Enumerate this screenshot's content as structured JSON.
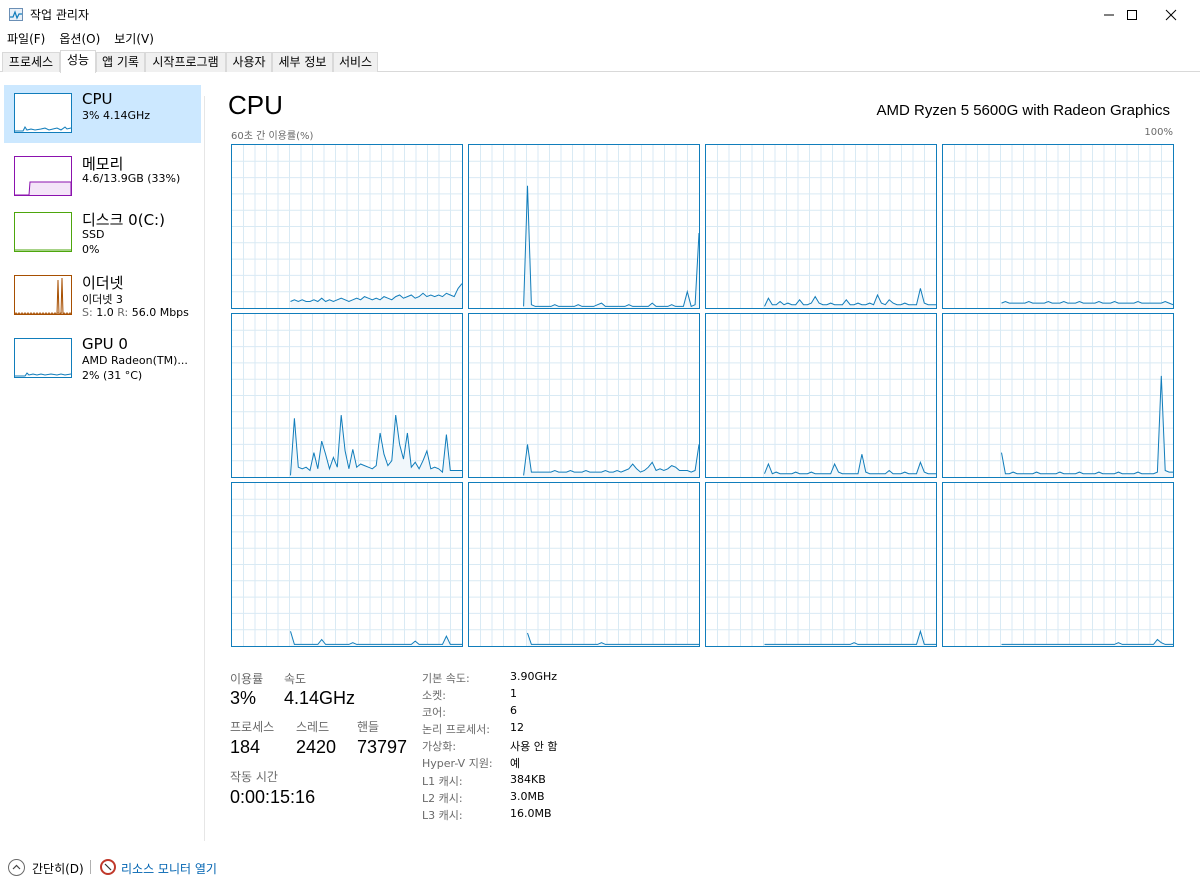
{
  "window": {
    "title": "작업 관리자"
  },
  "menu": [
    "파일(F)",
    "옵션(O)",
    "보기(V)"
  ],
  "tabs": [
    "프로세스",
    "성능",
    "앱 기록",
    "시작프로그램",
    "사용자",
    "세부 정보",
    "서비스"
  ],
  "active_tab": "성능",
  "resources": [
    {
      "title": "CPU",
      "sub1": "3% 4.14GHz",
      "sub2": "",
      "color": "#117dbb"
    },
    {
      "title": "메모리",
      "sub1": "4.6/13.9GB (33%)",
      "sub2": "",
      "color": "#8b12ae"
    },
    {
      "title": "디스크 0(C:)",
      "sub1": "SSD",
      "sub2": "0%",
      "color": "#4da60c"
    },
    {
      "title": "이더넷",
      "sub1": "이더넷 3",
      "sub2_s_label": "S:",
      "sub2_s_value": "1.0",
      "sub2_r_label": "R:",
      "sub2_r_value": "56.0 Mbps",
      "color": "#a74f01"
    },
    {
      "title": "GPU 0",
      "sub1": "AMD Radeon(TM)...",
      "sub2": "2% (31 °C)",
      "color": "#117dbb"
    }
  ],
  "main": {
    "title": "CPU",
    "model": "AMD Ryzen 5 5600G with Radeon Graphics",
    "axis_label": "60초 간 이용률(%)",
    "axis_max": "100%"
  },
  "stats": {
    "utilization_label": "이용률",
    "utilization": "3%",
    "speed_label": "속도",
    "speed": "4.14GHz",
    "processes_label": "프로세스",
    "processes": "184",
    "threads_label": "스레드",
    "threads": "2420",
    "handles_label": "핸들",
    "handles": "73797",
    "uptime_label": "작동 시간",
    "uptime": "0:00:15:16"
  },
  "specs": [
    {
      "label": "기본 속도:",
      "value": "3.90GHz"
    },
    {
      "label": "소켓:",
      "value": "1"
    },
    {
      "label": "코어:",
      "value": "6"
    },
    {
      "label": "논리 프로세서:",
      "value": "12"
    },
    {
      "label": "가상화:",
      "value": "사용 안 함"
    },
    {
      "label": "Hyper-V 지원:",
      "value": "예"
    },
    {
      "label": "L1 캐시:",
      "value": "384KB"
    },
    {
      "label": "L2 캐시:",
      "value": "3.0MB"
    },
    {
      "label": "L3 캐시:",
      "value": "16.0MB"
    }
  ],
  "footer": {
    "less": "간단히(D)",
    "resmon": "리소스 모니터 열기"
  },
  "colors": {
    "cpu": "#117dbb",
    "memory": "#8b12ae",
    "disk": "#4da60c",
    "ethernet": "#a74f01",
    "selected": "#cce8ff"
  },
  "chart_data": {
    "type": "line",
    "x": [
      0,
      1,
      2,
      3,
      4,
      5,
      6,
      7,
      8,
      9,
      10,
      11,
      12,
      13,
      14,
      15,
      16,
      17,
      18,
      19,
      20,
      21,
      22,
      23,
      24,
      25,
      26,
      27,
      28,
      29,
      30,
      31,
      32,
      33,
      34,
      35,
      36,
      37,
      38,
      39,
      40,
      41,
      42,
      43,
      44,
      45,
      46,
      47,
      48,
      49,
      50,
      51,
      52,
      53,
      54,
      55,
      56,
      57,
      58,
      59
    ],
    "xlim": [
      0,
      60
    ],
    "ylim": [
      0,
      100
    ],
    "series": [
      {
        "values": [
          null,
          null,
          null,
          null,
          null,
          null,
          null,
          null,
          null,
          null,
          null,
          null,
          null,
          null,
          null,
          4,
          5,
          4,
          5,
          4,
          4,
          5,
          4,
          6,
          4,
          5,
          4,
          5,
          6,
          5,
          4,
          5,
          6,
          5,
          7,
          6,
          5,
          6,
          5,
          7,
          6,
          5,
          7,
          8,
          6,
          7,
          8,
          6,
          7,
          9,
          7,
          8,
          7,
          8,
          7,
          9,
          8,
          7,
          12,
          15
        ]
      },
      {
        "values": [
          null,
          null,
          null,
          null,
          null,
          null,
          null,
          null,
          null,
          null,
          null,
          null,
          null,
          null,
          1,
          75,
          2,
          1,
          1,
          1,
          1,
          1,
          2,
          1,
          1,
          1,
          1,
          1,
          2,
          1,
          1,
          1,
          1,
          2,
          3,
          1,
          1,
          1,
          1,
          1,
          1,
          2,
          1,
          1,
          1,
          1,
          1,
          3,
          1,
          1,
          1,
          1,
          2,
          1,
          1,
          1,
          10,
          1,
          2,
          46
        ]
      },
      {
        "values": [
          null,
          null,
          null,
          null,
          null,
          null,
          null,
          null,
          null,
          null,
          null,
          null,
          null,
          null,
          null,
          1,
          6,
          2,
          2,
          4,
          2,
          3,
          2,
          2,
          5,
          2,
          2,
          3,
          7,
          3,
          2,
          2,
          3,
          2,
          2,
          2,
          5,
          2,
          2,
          3,
          2,
          2,
          3,
          2,
          8,
          3,
          2,
          5,
          3,
          2,
          2,
          3,
          2,
          2,
          2,
          12,
          3,
          2,
          2,
          2
        ]
      },
      {
        "values": [
          null,
          null,
          null,
          null,
          null,
          null,
          null,
          null,
          null,
          null,
          null,
          null,
          null,
          null,
          null,
          3,
          4,
          3,
          3,
          3,
          3,
          3,
          4,
          3,
          3,
          3,
          3,
          4,
          3,
          3,
          3,
          4,
          3,
          3,
          3,
          4,
          3,
          3,
          3,
          3,
          4,
          3,
          3,
          3,
          4,
          3,
          3,
          3,
          3,
          3,
          4,
          3,
          3,
          3,
          3,
          3,
          3,
          4,
          3,
          2
        ]
      },
      {
        "values": [
          null,
          null,
          null,
          null,
          null,
          null,
          null,
          null,
          null,
          null,
          null,
          null,
          null,
          null,
          null,
          1,
          36,
          6,
          5,
          6,
          4,
          15,
          5,
          22,
          14,
          5,
          12,
          6,
          38,
          16,
          5,
          17,
          6,
          8,
          7,
          6,
          5,
          7,
          27,
          14,
          7,
          10,
          38,
          20,
          11,
          27,
          6,
          9,
          5,
          10,
          16,
          5,
          6,
          5,
          3,
          26,
          4,
          4,
          4,
          4
        ]
      },
      {
        "values": [
          null,
          null,
          null,
          null,
          null,
          null,
          null,
          null,
          null,
          null,
          null,
          null,
          null,
          null,
          1,
          20,
          3,
          3,
          3,
          3,
          3,
          3,
          4,
          3,
          3,
          3,
          4,
          3,
          3,
          3,
          4,
          3,
          3,
          3,
          3,
          4,
          3,
          3,
          4,
          3,
          4,
          5,
          8,
          5,
          3,
          4,
          6,
          9,
          4,
          5,
          4,
          5,
          7,
          6,
          4,
          4,
          4,
          3,
          4,
          20
        ]
      },
      {
        "values": [
          null,
          null,
          null,
          null,
          null,
          null,
          null,
          null,
          null,
          null,
          null,
          null,
          null,
          null,
          null,
          2,
          8,
          2,
          3,
          2,
          2,
          2,
          2,
          3,
          2,
          2,
          2,
          3,
          2,
          2,
          2,
          2,
          2,
          8,
          3,
          2,
          2,
          2,
          2,
          2,
          14,
          3,
          2,
          2,
          2,
          2,
          2,
          4,
          2,
          2,
          2,
          3,
          2,
          2,
          2,
          9,
          3,
          2,
          2,
          2
        ]
      },
      {
        "values": [
          null,
          null,
          null,
          null,
          null,
          null,
          null,
          null,
          null,
          null,
          null,
          null,
          null,
          null,
          null,
          15,
          2,
          2,
          3,
          2,
          2,
          2,
          2,
          2,
          3,
          2,
          2,
          2,
          2,
          2,
          3,
          2,
          2,
          2,
          2,
          3,
          2,
          2,
          2,
          2,
          3,
          2,
          2,
          2,
          2,
          3,
          2,
          2,
          2,
          2,
          3,
          2,
          2,
          2,
          2,
          3,
          62,
          4,
          3,
          3
        ]
      },
      {
        "values": [
          null,
          null,
          null,
          null,
          null,
          null,
          null,
          null,
          null,
          null,
          null,
          null,
          null,
          null,
          null,
          9,
          1,
          1,
          1,
          1,
          1,
          1,
          1,
          4,
          1,
          1,
          1,
          1,
          1,
          1,
          1,
          2,
          1,
          1,
          1,
          1,
          1,
          1,
          1,
          1,
          1,
          1,
          1,
          1,
          1,
          1,
          1,
          3,
          1,
          1,
          1,
          1,
          1,
          1,
          1,
          6,
          1,
          1,
          1,
          1
        ]
      },
      {
        "values": [
          null,
          null,
          null,
          null,
          null,
          null,
          null,
          null,
          null,
          null,
          null,
          null,
          null,
          null,
          null,
          8,
          1,
          1,
          1,
          1,
          1,
          1,
          1,
          1,
          1,
          1,
          1,
          1,
          1,
          1,
          1,
          1,
          1,
          1,
          2,
          1,
          1,
          1,
          1,
          1,
          1,
          1,
          1,
          1,
          1,
          1,
          1,
          1,
          1,
          1,
          1,
          1,
          1,
          1,
          1,
          1,
          1,
          1,
          1,
          1
        ]
      },
      {
        "values": [
          null,
          null,
          null,
          null,
          null,
          null,
          null,
          null,
          null,
          null,
          null,
          null,
          null,
          null,
          null,
          1,
          1,
          1,
          1,
          1,
          1,
          1,
          1,
          1,
          1,
          1,
          1,
          1,
          1,
          1,
          1,
          1,
          1,
          1,
          1,
          1,
          1,
          1,
          2,
          1,
          1,
          1,
          1,
          1,
          1,
          1,
          1,
          1,
          1,
          1,
          1,
          1,
          1,
          1,
          1,
          9,
          1,
          1,
          1,
          1
        ]
      },
      {
        "values": [
          null,
          null,
          null,
          null,
          null,
          null,
          null,
          null,
          null,
          null,
          null,
          null,
          null,
          null,
          null,
          1,
          1,
          1,
          1,
          1,
          1,
          1,
          1,
          1,
          1,
          1,
          1,
          1,
          1,
          1,
          1,
          1,
          1,
          1,
          1,
          1,
          1,
          1,
          1,
          1,
          1,
          1,
          1,
          1,
          1,
          2,
          1,
          1,
          1,
          1,
          1,
          1,
          1,
          1,
          1,
          4,
          2,
          1,
          1,
          1
        ]
      }
    ]
  }
}
